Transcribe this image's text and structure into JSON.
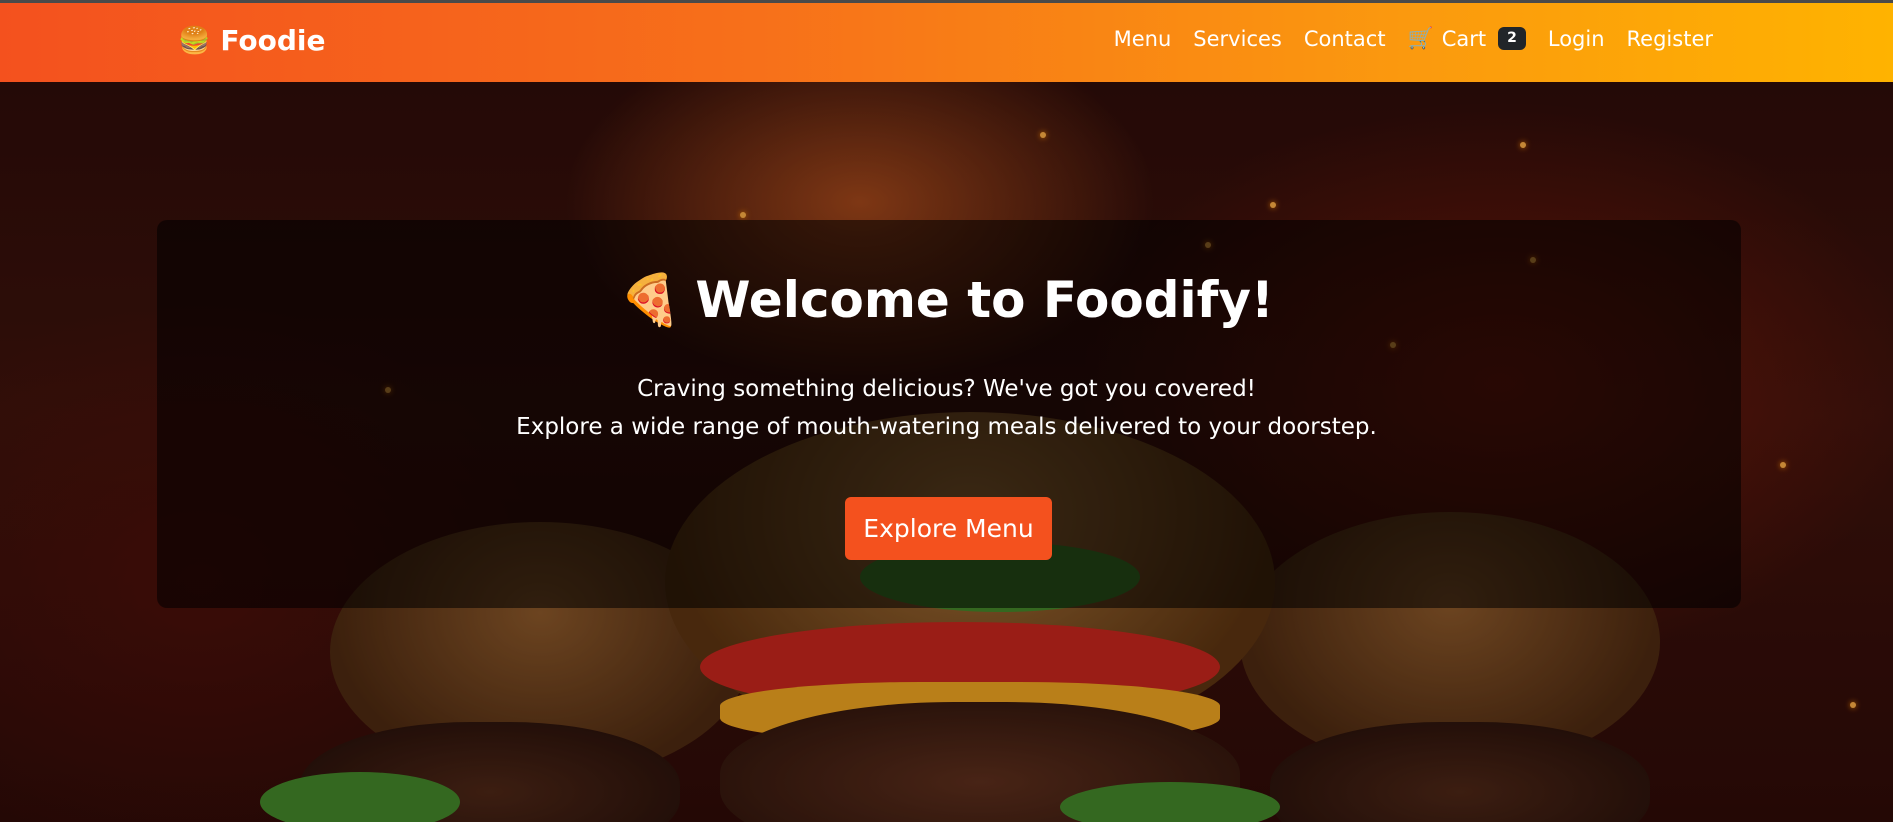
{
  "navbar": {
    "brand_icon": "🍔",
    "brand": "Foodie",
    "links": {
      "menu": "Menu",
      "services": "Services",
      "contact": "Contact",
      "cart": "Cart",
      "login": "Login",
      "register": "Register"
    },
    "cart_icon": "🛒",
    "cart_count": "2"
  },
  "hero": {
    "title_icon": "🍕",
    "title": "Welcome to Foodify!",
    "subtitle_line1": "Craving something delicious? We've got you covered!",
    "subtitle_line2": "Explore a wide range of mouth-watering meals delivered to your doorstep.",
    "cta_label": "Explore Menu",
    "background_image": "burgers-on-fire-photo"
  },
  "colors": {
    "nav_gradient_start": "#f4511e",
    "nav_gradient_end": "#ffb300",
    "cta": "#f4511e",
    "badge": "#212529"
  }
}
